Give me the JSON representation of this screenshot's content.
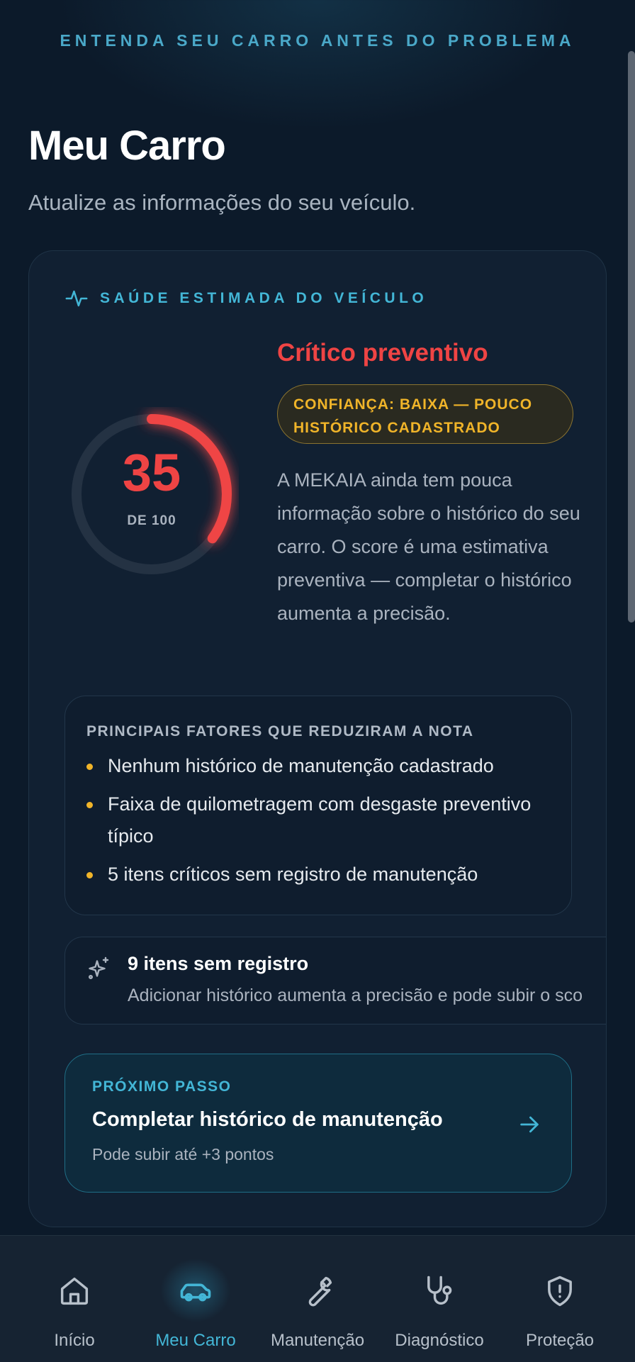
{
  "header": {
    "tagline": "ENTENDA SEU CARRO ANTES DO PROBLEMA",
    "title": "Meu Carro",
    "subtitle": "Atualize as informações do seu veículo."
  },
  "health": {
    "section_label": "SAÚDE ESTIMADA DO VEÍCULO",
    "score": "35",
    "score_value": 35,
    "score_max": 100,
    "score_suffix": "DE 100",
    "status": "Crítico preventivo",
    "confidence": "CONFIANÇA: BAIXA — POUCO HISTÓRICO CADASTRADO",
    "description": "A MEKAIA ainda tem pouca informação sobre o histórico do seu carro. O score é uma estimativa preventiva — completar o histórico aumenta a precisão.",
    "status_color": "#ef4444",
    "confidence_color": "#f0b429"
  },
  "factors": {
    "heading": "PRINCIPAIS FATORES QUE REDUZIRAM A NOTA",
    "items": [
      "Nenhum histórico de manutenção cadastrado",
      "Faixa de quilometragem com desgaste preventivo típico",
      "5 itens críticos sem registro de manutenção"
    ]
  },
  "missing": {
    "title": "9 itens sem registro",
    "description": "Adicionar histórico aumenta a precisão e pode subir o sco"
  },
  "next_step": {
    "eyebrow": "PRÓXIMO PASSO",
    "title": "Completar histórico de manutenção",
    "subtitle": "Pode subir até +3 pontos",
    "icon": "arrow-right-icon"
  },
  "nav": {
    "items": [
      {
        "label": "Início",
        "icon": "home-icon",
        "active": false
      },
      {
        "label": "Meu Carro",
        "icon": "car-icon",
        "active": true
      },
      {
        "label": "Manutenção",
        "icon": "wrench-icon",
        "active": false
      },
      {
        "label": "Diagnóstico",
        "icon": "stethoscope-icon",
        "active": false
      },
      {
        "label": "Proteção",
        "icon": "shield-icon",
        "active": false
      }
    ],
    "accent": "#43b6d6"
  }
}
